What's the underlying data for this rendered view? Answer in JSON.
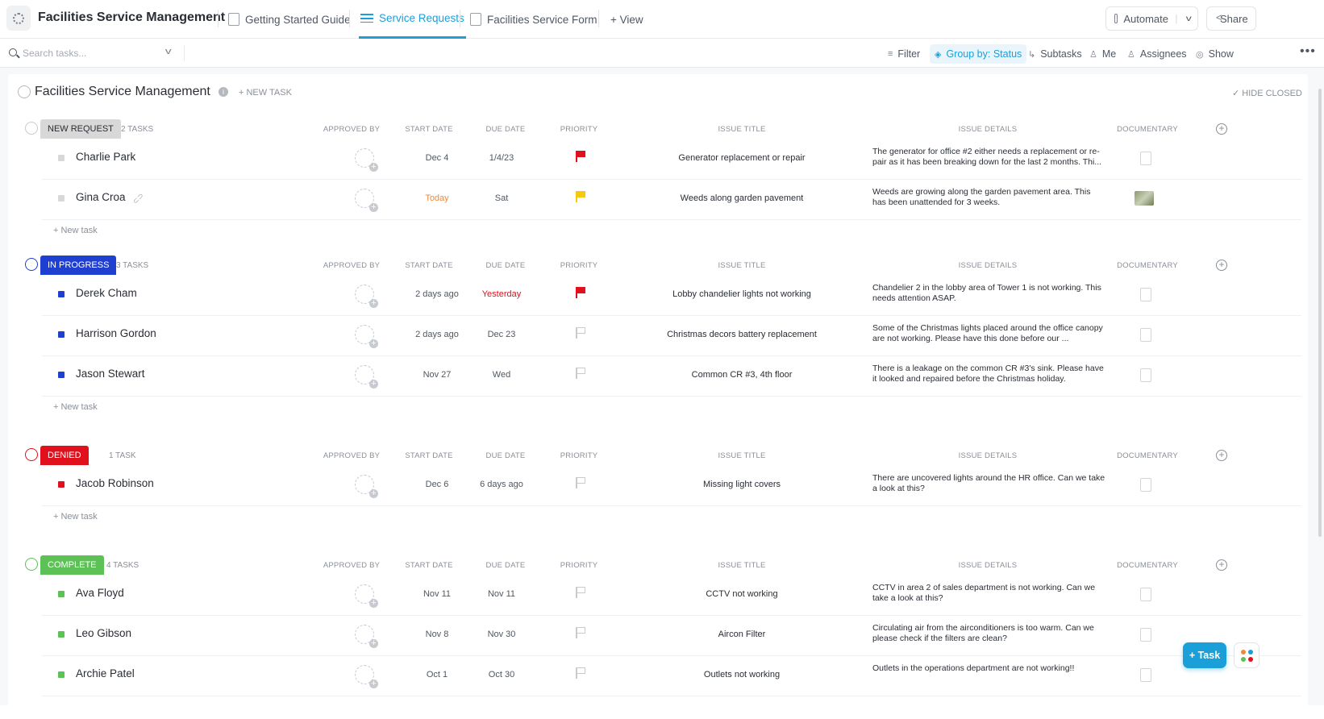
{
  "header": {
    "app_title": "Facilities Service Management",
    "tabs": [
      {
        "label": "Getting Started Guide"
      },
      {
        "label": "Service Requests"
      },
      {
        "label": "Facilities Service Form"
      }
    ],
    "add_view_label": "+ View",
    "automate_label": "Automate",
    "share_label": "Share"
  },
  "toolbar": {
    "search_placeholder": "Search tasks...",
    "filter_label": "Filter",
    "group_by_label": "Group by: Status",
    "subtasks_label": "Subtasks",
    "me_label": "Me",
    "assignees_label": "Assignees",
    "show_label": "Show"
  },
  "list": {
    "title": "Facilities Service Management",
    "new_task_label": "+ NEW TASK",
    "hide_closed_label": "✓ HIDE CLOSED",
    "add_task_row_label": "+ New task",
    "columns": {
      "approved_by": "APPROVED BY",
      "start_date": "START DATE",
      "due_date": "DUE DATE",
      "priority": "PRIORITY",
      "issue_title": "ISSUE TITLE",
      "issue_details": "ISSUE DETAILS",
      "documentary": "DOCUMENTARY"
    }
  },
  "groups": [
    {
      "status": "NEW REQUEST",
      "count": "2 TASKS",
      "color": "#d8d8d8",
      "text_color": "#292d34",
      "tasks": [
        {
          "name": "Charlie Park",
          "start": "Dec 4",
          "due": "1/4/23",
          "priority": "urgent",
          "issue_title": "Generator replacement or repair",
          "issue_details": "The generator for office #2 either needs a replacement or re-pair as it has been breaking down for the last 2 months. Thi...",
          "doc": "file"
        },
        {
          "name": "Gina Croa",
          "start": "Today",
          "due": "Sat",
          "priority": "high",
          "issue_title": "Weeds along garden pavement",
          "issue_details": "Weeds are growing along the garden pavement area. This has been unattended for 3 weeks.",
          "doc": "image",
          "attachment": true
        }
      ]
    },
    {
      "status": "IN PROGRESS",
      "count": "3 TASKS",
      "color": "#1f3fd1",
      "text_color": "#ffffff",
      "tasks": [
        {
          "name": "Derek Cham",
          "start": "2 days ago",
          "due": "Yesterday",
          "priority": "urgent",
          "issue_title": "Lobby chandelier lights not working",
          "issue_details": "Chandelier 2 in the lobby area of Tower 1 is not working. This needs attention ASAP.",
          "doc": "file"
        },
        {
          "name": "Harrison Gordon",
          "start": "2 days ago",
          "due": "Dec 23",
          "priority": "none",
          "issue_title": "Christmas decors battery replacement",
          "issue_details": "Some of the Christmas lights placed around the office canopy are not working. Please have this done before our ...",
          "doc": "file"
        },
        {
          "name": "Jason Stewart",
          "start": "Nov 27",
          "due": "Wed",
          "priority": "none",
          "issue_title": "Common CR #3, 4th floor",
          "issue_details": "There is a leakage on the common CR #3's sink. Please have it looked and repaired before the Christmas holiday.",
          "doc": "file"
        }
      ]
    },
    {
      "status": "DENIED",
      "count": "1 TASK",
      "color": "#e0101c",
      "text_color": "#ffffff",
      "tasks": [
        {
          "name": "Jacob Robinson",
          "start": "Dec 6",
          "due": "6 days ago",
          "priority": "none",
          "issue_title": "Missing light covers",
          "issue_details": "There are uncovered lights around the HR office. Can we take a look at this?",
          "doc": "file"
        }
      ]
    },
    {
      "status": "COMPLETE",
      "count": "4 TASKS",
      "color": "#5cc255",
      "text_color": "#ffffff",
      "tasks": [
        {
          "name": "Ava Floyd",
          "start": "Nov 11",
          "due": "Nov 11",
          "priority": "none",
          "issue_title": "CCTV not working",
          "issue_details": "CCTV in area 2 of sales department is not working. Can we take a look at this?",
          "doc": "file"
        },
        {
          "name": "Leo Gibson",
          "start": "Nov 8",
          "due": "Nov 30",
          "priority": "none",
          "issue_title": "Aircon Filter",
          "issue_details": "Circulating air from the airconditioners is too warm. Can we please check if the filters are clean?",
          "doc": "file"
        },
        {
          "name": "Archie Patel",
          "start": "Oct 1",
          "due": "Oct 30",
          "priority": "none",
          "issue_title": "Outlets not working",
          "issue_details": "Outlets in the operations department are not working!!",
          "doc": "file"
        }
      ]
    }
  ],
  "colors": {
    "accent": "#1a9fd9",
    "today": "#f0883a",
    "overdue": "#e0101c",
    "flag_urgent": "#e0101c",
    "flag_high": "#f7c90b",
    "flag_none": "#c7cacf"
  },
  "fab_label": "+ Task"
}
